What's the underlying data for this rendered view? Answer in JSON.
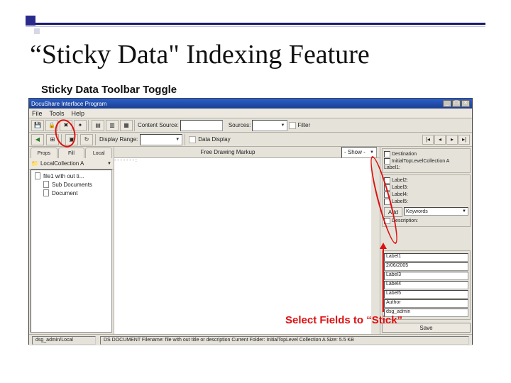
{
  "slide": {
    "title": "“Sticky Data\" Indexing Feature",
    "annotation_top": "Sticky Data Toolbar Toggle",
    "annotation_bottom": "Select Fields to “Stick”"
  },
  "window": {
    "title": "DocuShare Interface Program",
    "menu": [
      "File",
      "Tools",
      "Help"
    ],
    "toolbar1": {
      "content_source_label": "Content Source:",
      "content_source_value": "",
      "source_label": "Sources:",
      "source_value": "",
      "filter_label": "Filter"
    },
    "toolbar2": {
      "display_range_label": "Display Range:",
      "data_display_label": "Data Display",
      "nav": [
        "|◂",
        "◂",
        "▸",
        "▸|"
      ]
    },
    "left_tabs": [
      "Props",
      "Fill",
      "Local"
    ],
    "left_head": "LocalCollection A",
    "tree": [
      {
        "name": "file1 with out ti...",
        "child": false
      },
      {
        "name": "Sub Documents",
        "child": true
      },
      {
        "name": "Document",
        "child": true
      }
    ],
    "center_toolbar": {
      "label": "Free Drawing Markup",
      "show_label": "- Show -"
    },
    "right": {
      "destination_label": "Destination",
      "initial_top_label": "InitialTopLevelCollection A",
      "fields": [
        {
          "cb": "",
          "label": "Label1:"
        },
        {
          "cb": "",
          "label": "Label2:"
        },
        {
          "cb": "",
          "label": "Label3:"
        },
        {
          "cb": "",
          "label": "Label4:"
        },
        {
          "cb": "",
          "label": "Label5:"
        }
      ],
      "add_btn": "Add",
      "keywords_label": "Keywords",
      "desc_label": "Description:",
      "values": [
        {
          "label": "Label1"
        },
        {
          "val": "2/06/2005"
        },
        {
          "label": "Label3"
        },
        {
          "label": "Label4"
        },
        {
          "label": "Label5"
        },
        {
          "label": "Author"
        },
        {
          "label": "dsg_admin"
        }
      ],
      "save_btn": "Save"
    },
    "status": {
      "left": "dsg_admin/Local",
      "center": "DS DOCUMENT  Filename: file with out title or description  Current Folder: InitialTopLevel Collection A  Size: 5.5 KB"
    }
  }
}
